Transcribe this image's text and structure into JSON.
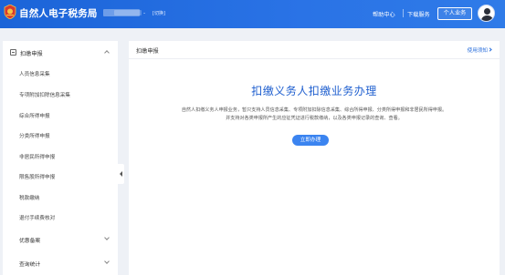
{
  "header": {
    "app_title": "自然人电子税务局",
    "separator": "-",
    "switch_label": "[切换]",
    "nav": {
      "help_center": "帮助中心",
      "download_service": "下载服务",
      "personal_business": "个人业务"
    },
    "colors": {
      "bar": "#2a73e6",
      "text": "#ffffff"
    }
  },
  "sidebar": {
    "section_title": "扣缴申报",
    "items": [
      {
        "label": "人员信息采集"
      },
      {
        "label": "专项附加扣除信息采集"
      },
      {
        "label": "综合所得申报"
      },
      {
        "label": "分类所得申报"
      },
      {
        "label": "非居民所得申报"
      },
      {
        "label": "限售股所得申报"
      },
      {
        "label": "税款缴纳"
      },
      {
        "label": "退付手续费核对"
      }
    ],
    "groups": [
      {
        "label": "优惠备案"
      },
      {
        "label": "查询统计"
      }
    ]
  },
  "main": {
    "panel_title": "扣缴申报",
    "notice_link": "使用须知",
    "hero_title": "扣缴义务人扣缴业务办理",
    "description": [
      "自然人扣缴义务人申报业务，暂只支持人员信息采集、专项附加扣除信息采集、综合所得申报、分类所得申报和非居民所得申报。",
      "并支持对各类申报所产生的应征凭证进行税款缴纳，以及各类申报记录的查询、查看。"
    ],
    "start_button": "立即办理",
    "colors": {
      "accent": "#3b84f0",
      "title": "#1f5fcf"
    }
  }
}
